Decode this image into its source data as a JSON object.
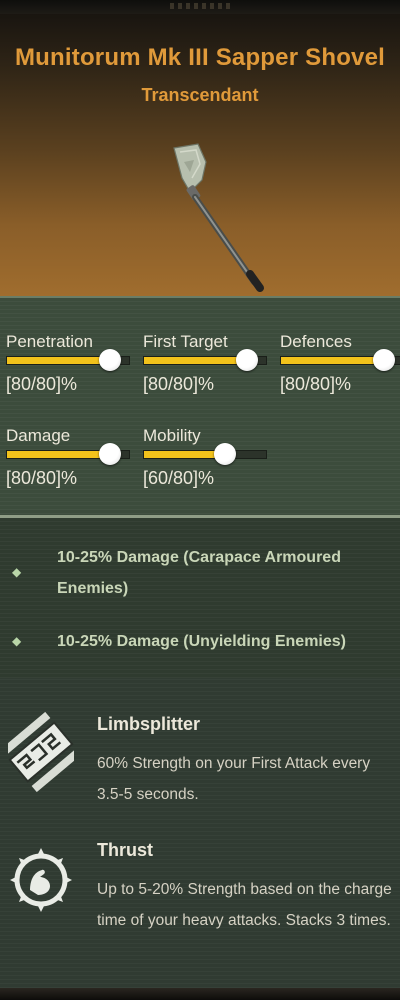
{
  "item": {
    "name": "Munitorum Mk III Sapper Shovel",
    "rarity": "Transcendant"
  },
  "colors": {
    "title": "#e09a3a",
    "bar_fill": "#f2c21b",
    "panel": "#3c4c3c",
    "modifier_text": "#c9d6b8"
  },
  "stats": [
    {
      "name": "Penetration",
      "value_text": "[80/80]%",
      "level": 0.8
    },
    {
      "name": "First Target",
      "value_text": "[80/80]%",
      "level": 0.8
    },
    {
      "name": "Defences",
      "value_text": "[80/80]%",
      "level": 0.8
    },
    {
      "name": "Damage",
      "value_text": "[80/80]%",
      "level": 0.8
    },
    {
      "name": "Mobility",
      "value_text": "[60/80]%",
      "level": 0.6
    }
  ],
  "modifiers": [
    {
      "icon": "diamond-bullet-icon",
      "text": "10-25% Damage (Carapace Armoured Enemies)"
    },
    {
      "icon": "diamond-bullet-icon",
      "text": "10-25% Damage (Unyielding Enemies)"
    }
  ],
  "perks": [
    {
      "icon": "limbsplitter-blade-icon",
      "name": "Limbsplitter",
      "description": "60% Strength on your First Attack every 3.5-5 seconds."
    },
    {
      "icon": "flexed-arm-emblem-icon",
      "name": "Thrust",
      "description": "Up to 5-20% Strength based on the charge time of your heavy attacks. Stacks 3 times."
    }
  ]
}
